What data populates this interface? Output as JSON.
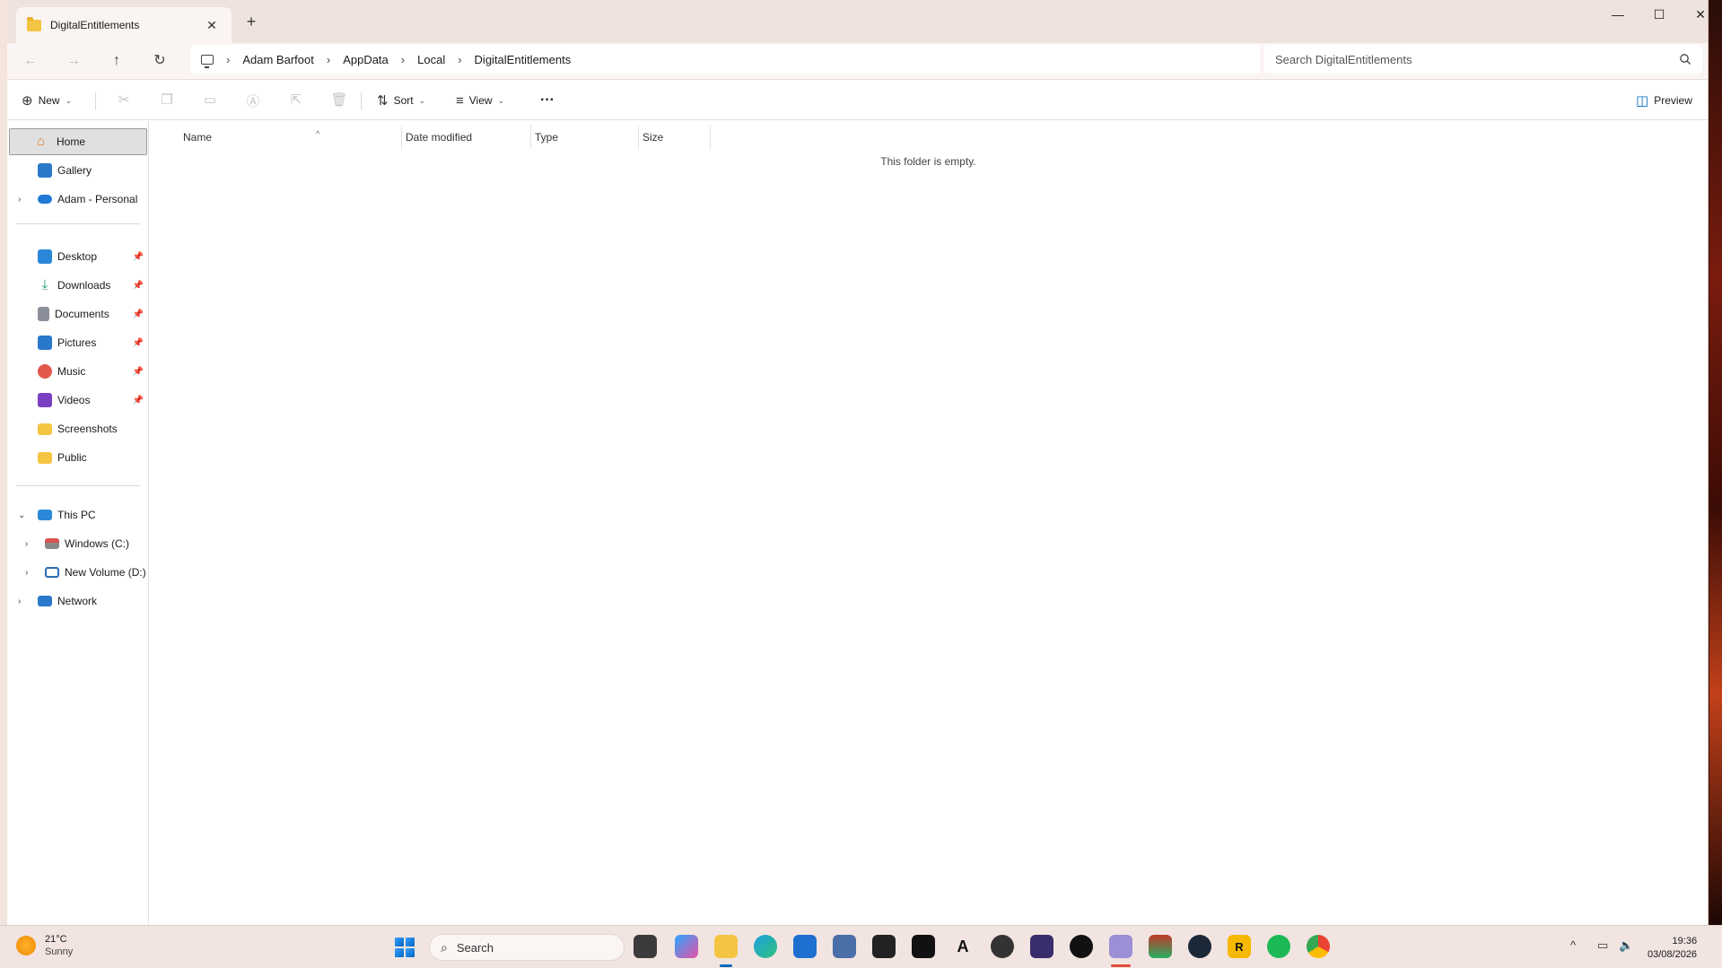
{
  "window": {
    "tab_title": "DigitalEntitlements",
    "tab_close": "✕",
    "new_tab": "+",
    "minimize": "—",
    "maximize": "☐",
    "close": "✕"
  },
  "nav": {
    "back": "←",
    "forward": "→",
    "up": "↑",
    "refresh": "↻"
  },
  "breadcrumb": [
    "Adam Barfoot",
    "AppData",
    "Local",
    "DigitalEntitlements"
  ],
  "breadcrumb_sep": "›",
  "search": {
    "placeholder": "Search DigitalEntitlements",
    "icon": "search-icon"
  },
  "toolbar": {
    "new_label": "New",
    "sort_label": "Sort",
    "view_label": "View",
    "more_label": "···",
    "preview_label": "Preview",
    "disabled_icons": [
      "cut-icon",
      "copy-icon",
      "paste-icon",
      "rename-icon",
      "share-icon",
      "delete-icon"
    ]
  },
  "sidebar": {
    "home": "Home",
    "gallery": "Gallery",
    "onedrive": "Adam - Personal",
    "quick_access": [
      {
        "label": "Desktop",
        "pinned": true,
        "icon": "desktop-icon",
        "color": "#2b88d8"
      },
      {
        "label": "Downloads",
        "pinned": true,
        "icon": "download-icon",
        "color": "#1c9a6c"
      },
      {
        "label": "Documents",
        "pinned": true,
        "icon": "document-icon",
        "color": "#8a8f99"
      },
      {
        "label": "Pictures",
        "pinned": true,
        "icon": "pictures-icon",
        "color": "#2a78c9"
      },
      {
        "label": "Music",
        "pinned": true,
        "icon": "music-icon",
        "color": "#e2584b"
      },
      {
        "label": "Videos",
        "pinned": true,
        "icon": "videos-icon",
        "color": "#7b3fc2"
      },
      {
        "label": "Screenshots",
        "pinned": false,
        "icon": "folder-icon",
        "color": "#f4c542"
      },
      {
        "label": "Public",
        "pinned": false,
        "icon": "folder-icon",
        "color": "#f4c542"
      }
    ],
    "this_pc": "This PC",
    "drives": [
      "Windows (C:)",
      "New Volume (D:)"
    ],
    "network": "Network"
  },
  "columns": [
    "Name",
    "Date modified",
    "Type",
    "Size"
  ],
  "empty_message": "This folder is empty.",
  "taskbar": {
    "temperature": "21°C",
    "condition": "Sunny",
    "search_label": "Search",
    "time": "19:36",
    "date": "03/08/2026"
  },
  "colors": {
    "accent": "#0067c0",
    "titlebar": "#efe3de",
    "taskbar": "#f1e4e1"
  }
}
